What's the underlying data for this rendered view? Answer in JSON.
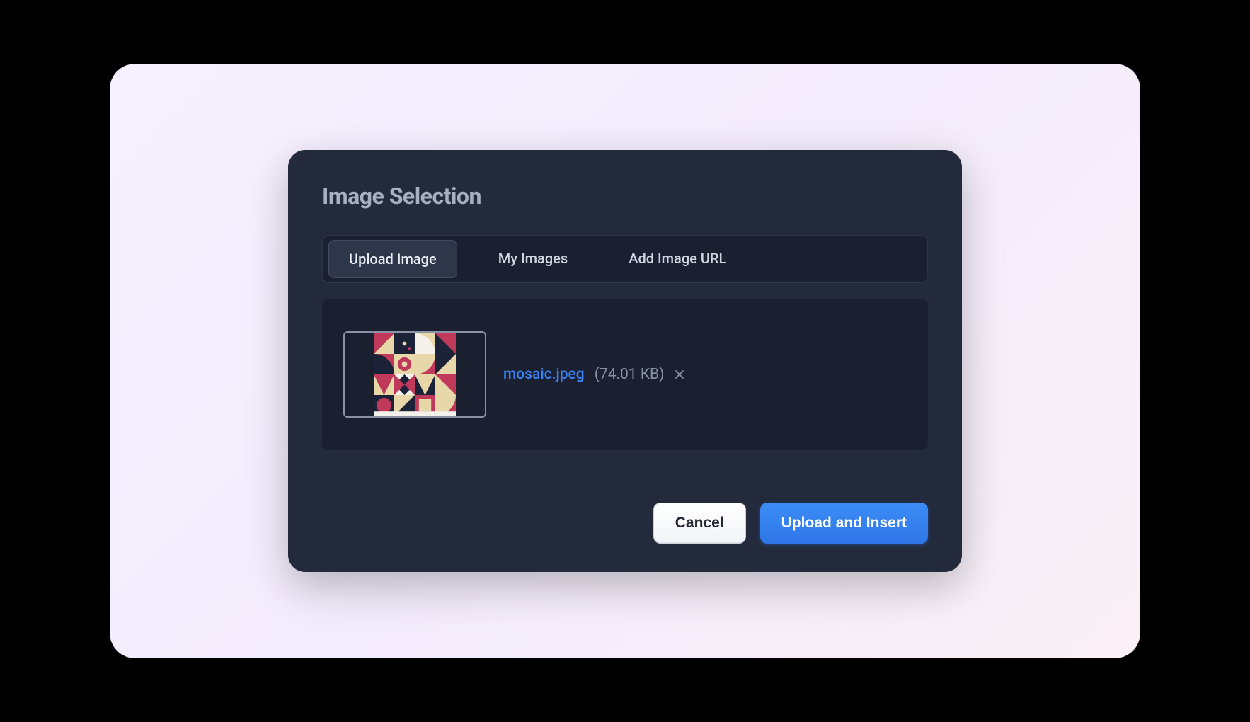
{
  "modal": {
    "title": "Image Selection",
    "tabs": [
      {
        "label": "Upload Image",
        "active": true
      },
      {
        "label": "My Images",
        "active": false
      },
      {
        "label": "Add Image URL",
        "active": false
      }
    ],
    "file": {
      "name": "mosaic.jpeg",
      "size": "(74.01 KB)"
    },
    "buttons": {
      "cancel": "Cancel",
      "confirm": "Upload and Insert"
    }
  }
}
